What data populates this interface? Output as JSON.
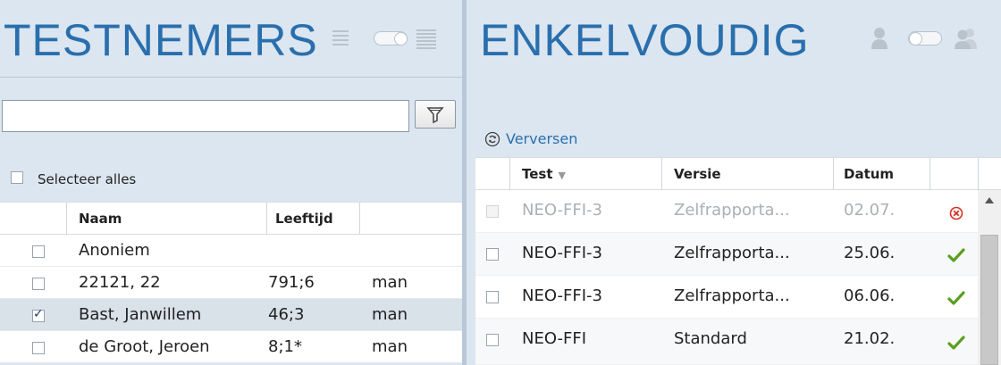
{
  "left_panel": {
    "title": "TESTNEMERS",
    "search": {
      "value": "",
      "placeholder": ""
    },
    "filter_icon": "filter-icon",
    "select_all_label": "Selecteer alles",
    "columns": [
      "Naam",
      "Leeftijd",
      ""
    ],
    "rows": [
      {
        "name": "Anoniem",
        "age": "",
        "gender": "",
        "checked": false
      },
      {
        "name": "22121, 22",
        "age": "791;6",
        "gender": "man",
        "checked": false
      },
      {
        "name": "Bast, Janwillem",
        "age": "46;3",
        "gender": "man",
        "checked": true
      },
      {
        "name": "de Groot, Jeroen",
        "age": "8;1*",
        "gender": "man",
        "checked": false
      }
    ]
  },
  "right_panel": {
    "title": "ENKELVOUDIG",
    "refresh_label": "Verversen",
    "columns": [
      "Test",
      "Versie",
      "Datum",
      ""
    ],
    "rows": [
      {
        "test": "NEO-FFI-3",
        "version": "Zelfrapporta...",
        "date": "02.07.",
        "status": "error",
        "disabled": true
      },
      {
        "test": "NEO-FFI-3",
        "version": "Zelfrapporta...",
        "date": "25.06.",
        "status": "ok",
        "disabled": false
      },
      {
        "test": "NEO-FFI-3",
        "version": "Zelfrapporta...",
        "date": "06.06.",
        "status": "ok",
        "disabled": false
      },
      {
        "test": "NEO-FFI",
        "version": "Standard",
        "date": "21.02.",
        "status": "ok",
        "disabled": false
      }
    ]
  },
  "colors": {
    "title": "#2a6fad",
    "panel_bg": "#dce6f0",
    "selected_row": "#d9e1e9",
    "ok": "#5a9e1e",
    "error": "#d93025"
  }
}
